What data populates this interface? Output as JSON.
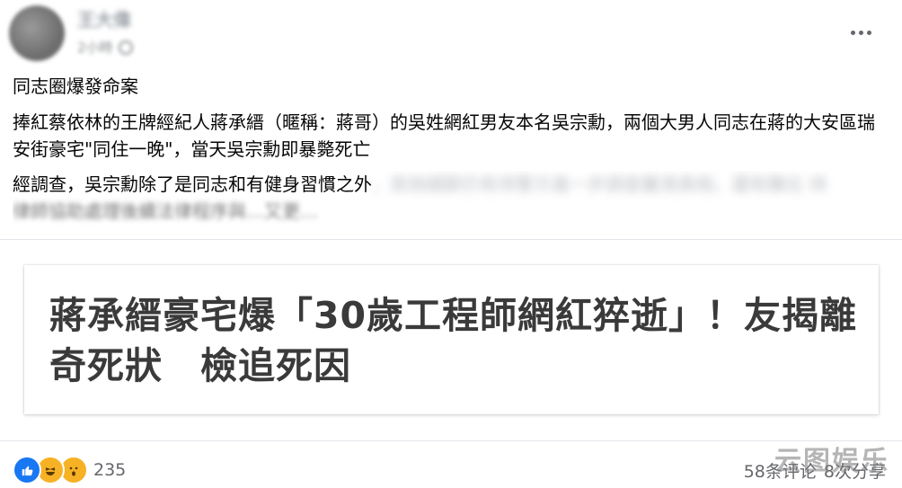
{
  "post": {
    "author": "王大偉",
    "time": "2小時",
    "title_line": "同志圈爆發命案",
    "body_para1": "捧紅蔡依林的王牌經紀人蔣承縉（暱稱：蔣哥）的吳姓網紅男友本名吳宗勳，兩個大男人同志在蔣的大安區瑞安街豪宅\"同住一晚\"，當天吳宗勳即暴斃死亡",
    "body_para2_visible": "經調查，吳宗勳除了是同志和有健身習慣之外",
    "body_para2_blurred": "，其他細節仍有待警方進一步調查釐清真相，還有職位 待",
    "body_para2_cut": "律師協助處理後續法律程序與…又更…"
  },
  "link_card": {
    "title": "蔣承縉豪宅爆「30歲工程師網紅猝逝」！友揭離奇死狀　檢追死因"
  },
  "footer": {
    "reaction_icons": [
      "like-icon",
      "haha-icon",
      "wow-icon"
    ],
    "reaction_count": "235",
    "comments": "58条评论",
    "shares": "8次分享"
  },
  "watermark": "云图娱乐",
  "colors": {
    "like": "#1877f2",
    "emoji": "#f7b125",
    "secondary_text": "#65676b",
    "card_title": "#3a3a3a"
  }
}
